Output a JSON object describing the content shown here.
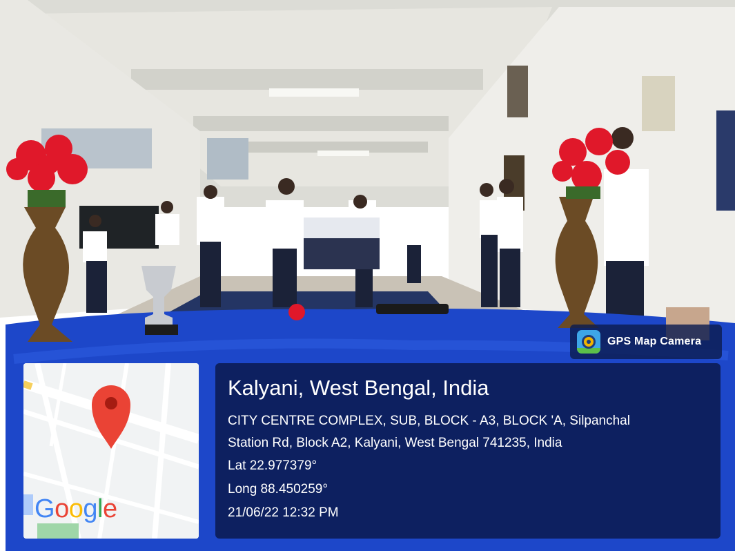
{
  "badge": {
    "label": "GPS Map Camera",
    "icon": "gps-map-camera-icon"
  },
  "map": {
    "logo": [
      "G",
      "o",
      "o",
      "g",
      "l",
      "e"
    ],
    "pin_icon": "map-pin-icon",
    "pin_color": "#ea4335"
  },
  "location": {
    "place": "Kalyani, West Bengal, India",
    "address_line1": "CITY CENTRE COMPLEX, SUB, BLOCK - A3, BLOCK 'A, Silpanchal",
    "address_line2": "Station Rd, Block A2, Kalyani, West Bengal 741235, India",
    "lat": "Lat 22.977379°",
    "long": "Long 88.450259°",
    "datetime": "21/06/22 12:32 PM"
  },
  "colors": {
    "table_cloth": "#1d47c9",
    "panel": "#0a1a4e",
    "flowers": "#e0182a"
  }
}
